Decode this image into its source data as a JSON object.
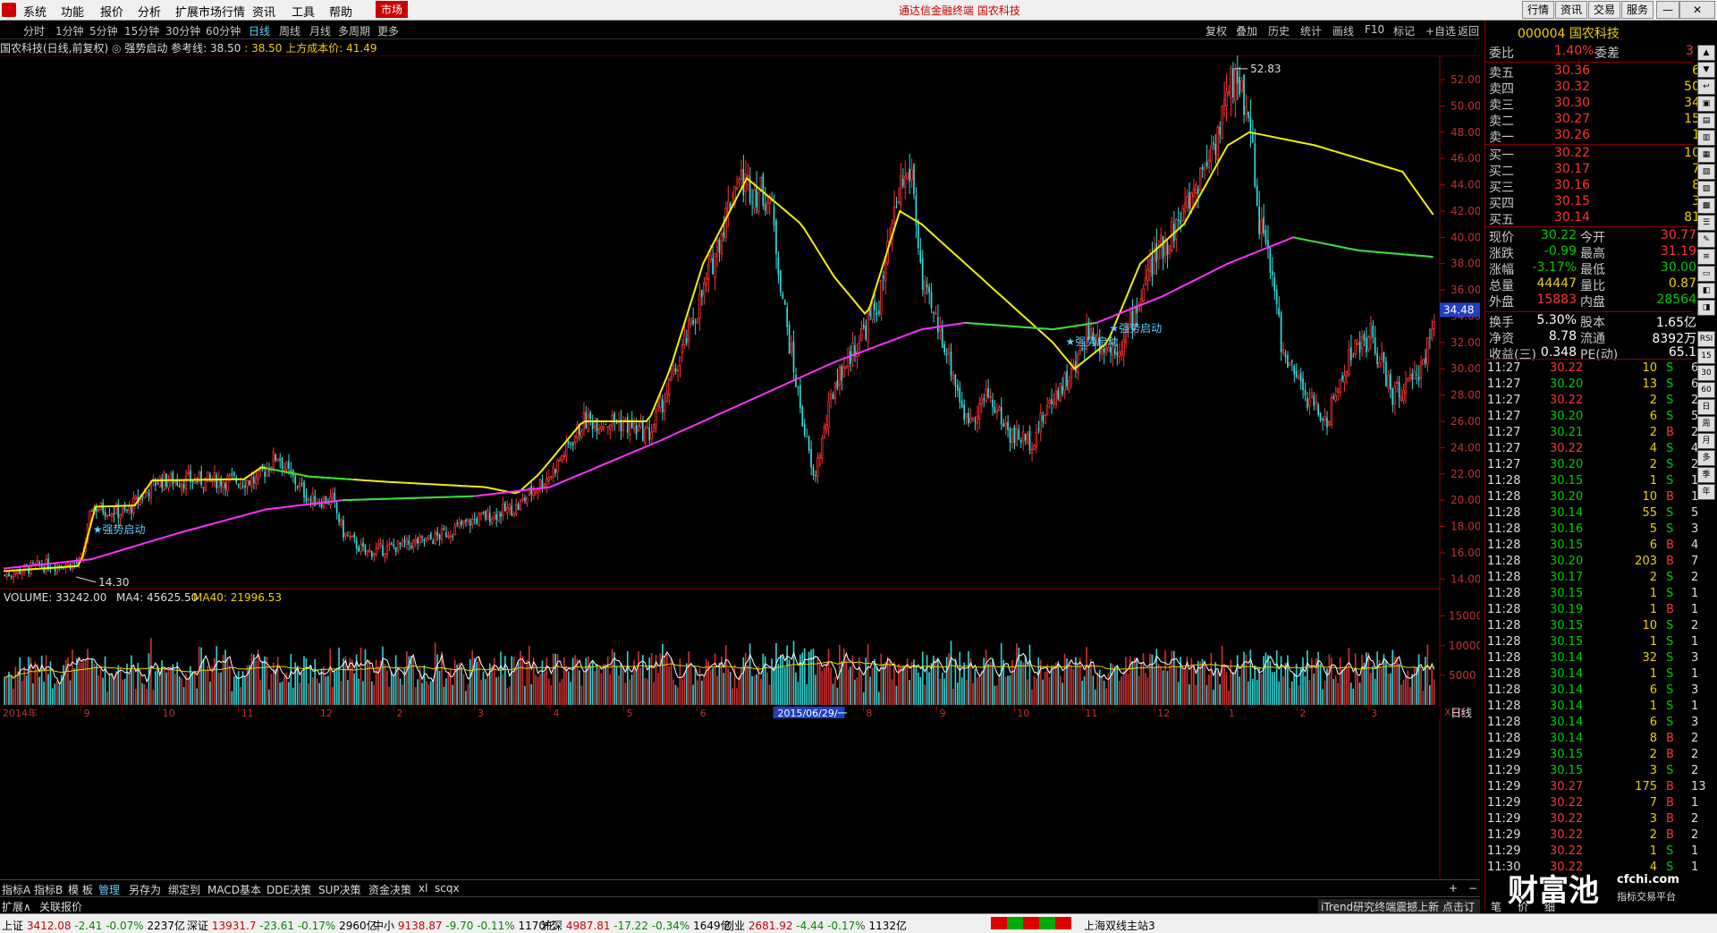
{
  "menu": {
    "items": [
      "系统",
      "功能",
      "报价",
      "分析",
      "扩展市场行情",
      "资讯",
      "工具",
      "帮助"
    ],
    "market": "市场",
    "center_title": "通达信金融终端 国农科技",
    "right_buttons": [
      "行情",
      "资讯",
      "交易",
      "服务"
    ]
  },
  "periods": {
    "items": [
      "分时",
      "1分钟",
      "5分钟",
      "15分钟",
      "30分钟",
      "60分钟",
      "日线",
      "周线",
      "月线",
      "多周期",
      "更多"
    ],
    "selected": "日线",
    "right_items": [
      "复权",
      "叠加",
      "历史",
      "统计",
      "画线",
      "F10",
      "标记",
      "+自选",
      "返回"
    ]
  },
  "chart_info": {
    "name": "国农科技(日线,前复权)",
    "indicator": "强势启动",
    "ref_label": "参考线: 38.50",
    "ref_value": ": 38.50",
    "cost_label": "上方成本价: 41.49"
  },
  "chart_data": {
    "type": "candlestick",
    "price_axis": [
      "52.00",
      "50.00",
      "48.00",
      "46.00",
      "44.00",
      "42.00",
      "40.00",
      "38.00",
      "36.00",
      "34.00",
      "32.00",
      "30.00",
      "28.00",
      "26.00",
      "24.00",
      "22.00",
      "20.00",
      "18.00",
      "16.00",
      "14.00"
    ],
    "price_range": [
      13.0,
      53.5
    ],
    "high_label": "52.83",
    "low_label": "14.30",
    "current_price_tag": "34.48",
    "signal_label": "★强势启动",
    "month_labels": [
      "2014年",
      "9",
      "10",
      "11",
      "12",
      "2",
      "3",
      "4",
      "5",
      "6",
      "2015/06/29/一",
      "8",
      "9",
      "10",
      "11",
      "12",
      "1",
      "2",
      "3"
    ],
    "selected_date": "2015/06/29/一",
    "period_tag": "日线",
    "price_anchors": [
      [
        0,
        14.3
      ],
      [
        15,
        15
      ],
      [
        35,
        15.2
      ],
      [
        40,
        19.5
      ],
      [
        55,
        19
      ],
      [
        70,
        21.5
      ],
      [
        95,
        21.5
      ],
      [
        115,
        21.5
      ],
      [
        125,
        23.5
      ],
      [
        130,
        22
      ],
      [
        140,
        20
      ],
      [
        150,
        20
      ],
      [
        155,
        17.5
      ],
      [
        165,
        16
      ],
      [
        180,
        16.5
      ],
      [
        195,
        17
      ],
      [
        215,
        18.5
      ],
      [
        235,
        19.5
      ],
      [
        240,
        20.5
      ],
      [
        250,
        22
      ],
      [
        265,
        26
      ],
      [
        280,
        26
      ],
      [
        295,
        25
      ],
      [
        305,
        29
      ],
      [
        320,
        36
      ],
      [
        335,
        44.5
      ],
      [
        350,
        43
      ],
      [
        358,
        33
      ],
      [
        362,
        29
      ],
      [
        370,
        21.5
      ],
      [
        380,
        29
      ],
      [
        390,
        32
      ],
      [
        400,
        35
      ],
      [
        410,
        44
      ],
      [
        415,
        45
      ],
      [
        420,
        36
      ],
      [
        430,
        32
      ],
      [
        440,
        26
      ],
      [
        450,
        28
      ],
      [
        460,
        25
      ],
      [
        470,
        24.5
      ],
      [
        480,
        28
      ],
      [
        490,
        30
      ],
      [
        495,
        33
      ],
      [
        505,
        31.5
      ],
      [
        512,
        32
      ],
      [
        525,
        38
      ],
      [
        540,
        42
      ],
      [
        555,
        48
      ],
      [
        563,
        52.5
      ],
      [
        570,
        49
      ],
      [
        573,
        42
      ],
      [
        580,
        37
      ],
      [
        585,
        31
      ],
      [
        595,
        28
      ],
      [
        605,
        26
      ],
      [
        615,
        31
      ],
      [
        625,
        32.5
      ],
      [
        635,
        28
      ],
      [
        645,
        29
      ],
      [
        655,
        33.5
      ]
    ],
    "ma_yellow": [
      [
        0,
        14.6
      ],
      [
        35,
        15
      ],
      [
        42,
        19.5
      ],
      [
        60,
        19.6
      ],
      [
        68,
        21.5
      ],
      [
        110,
        21.6
      ],
      [
        118,
        22.5
      ],
      [
        140,
        21.8
      ],
      [
        175,
        21.4
      ],
      [
        220,
        21
      ],
      [
        235,
        20.5
      ],
      [
        245,
        22
      ],
      [
        265,
        26
      ],
      [
        295,
        26
      ],
      [
        305,
        30
      ],
      [
        320,
        38
      ],
      [
        340,
        44.5
      ],
      [
        365,
        41
      ],
      [
        380,
        37
      ],
      [
        395,
        34
      ],
      [
        410,
        42
      ],
      [
        420,
        41
      ],
      [
        440,
        38
      ],
      [
        460,
        35
      ],
      [
        480,
        32
      ],
      [
        490,
        30
      ],
      [
        505,
        32
      ],
      [
        520,
        38
      ],
      [
        540,
        41
      ],
      [
        560,
        47
      ],
      [
        570,
        48
      ],
      [
        600,
        47
      ],
      [
        640,
        45
      ],
      [
        655,
        41.5
      ]
    ],
    "ma_green_magenta": [
      [
        0,
        14.8
      ],
      [
        40,
        15.5
      ],
      [
        80,
        17.5
      ],
      [
        120,
        19.3
      ],
      [
        155,
        20
      ],
      [
        215,
        20.3
      ],
      [
        250,
        21
      ],
      [
        300,
        24.5
      ],
      [
        340,
        27.5
      ],
      [
        380,
        30.5
      ],
      [
        420,
        33
      ],
      [
        440,
        33.5
      ],
      [
        480,
        33
      ],
      [
        500,
        33.5
      ],
      [
        530,
        35.5
      ],
      [
        560,
        38
      ],
      [
        590,
        40
      ],
      [
        620,
        39
      ],
      [
        655,
        38.5
      ]
    ],
    "volume": {
      "label": "VOLUME: 33242.00",
      "ma4_label": "MA4: 45625.50",
      "ma40_label": "MA40: 21996.53",
      "axis": [
        "15000",
        "10000",
        "5000"
      ],
      "tag": "X10"
    }
  },
  "quote": {
    "code": "000004",
    "name": "国农科技",
    "weibi": {
      "label": "委比",
      "value": "1.40%",
      "label2": "委差",
      "value2": "3"
    },
    "asks": [
      {
        "label": "卖五",
        "price": "30.36",
        "vol": "6"
      },
      {
        "label": "卖四",
        "price": "30.32",
        "vol": "50"
      },
      {
        "label": "卖三",
        "price": "30.30",
        "vol": "34"
      },
      {
        "label": "卖二",
        "price": "30.27",
        "vol": "15"
      },
      {
        "label": "卖一",
        "price": "30.26",
        "vol": "1"
      }
    ],
    "bids": [
      {
        "label": "买一",
        "price": "30.22",
        "vol": "10"
      },
      {
        "label": "买二",
        "price": "30.17",
        "vol": "7"
      },
      {
        "label": "买三",
        "price": "30.16",
        "vol": "8"
      },
      {
        "label": "买四",
        "price": "30.15",
        "vol": "3"
      },
      {
        "label": "买五",
        "price": "30.14",
        "vol": "81"
      }
    ],
    "stats": [
      {
        "l": "现价",
        "v": "30.22",
        "c": "dn",
        "l2": "今开",
        "v2": "30.77",
        "c2": "up"
      },
      {
        "l": "涨跌",
        "v": "-0.99",
        "c": "dn",
        "l2": "最高",
        "v2": "31.19",
        "c2": "up"
      },
      {
        "l": "涨幅",
        "v": "-3.17%",
        "c": "dn",
        "l2": "最低",
        "v2": "30.00",
        "c2": "dn"
      },
      {
        "l": "总量",
        "v": "44447",
        "c": "yl",
        "l2": "量比",
        "v2": "0.87",
        "c2": "yl"
      },
      {
        "l": "外盘",
        "v": "15883",
        "c": "up",
        "l2": "内盘",
        "v2": "28564",
        "c2": "dn"
      }
    ],
    "fin": [
      {
        "l": "换手",
        "v": "5.30%",
        "l2": "股本",
        "v2": "1.65亿"
      },
      {
        "l": "净资",
        "v": "8.78",
        "l2": "流通",
        "v2": "8392万"
      },
      {
        "l": "收益(三)",
        "v": "0.348",
        "l2": "PE(动)",
        "v2": "65.1"
      }
    ],
    "ticks": [
      [
        "11:27",
        "30.22",
        "10",
        "S",
        "6"
      ],
      [
        "11:27",
        "30.20",
        "13",
        "S",
        "6"
      ],
      [
        "11:27",
        "30.22",
        "2",
        "S",
        "2"
      ],
      [
        "11:27",
        "30.20",
        "6",
        "S",
        "5"
      ],
      [
        "11:27",
        "30.21",
        "2",
        "B",
        "2"
      ],
      [
        "11:27",
        "30.22",
        "4",
        "S",
        "4"
      ],
      [
        "11:27",
        "30.20",
        "2",
        "S",
        "2"
      ],
      [
        "11:28",
        "30.15",
        "1",
        "S",
        "1"
      ],
      [
        "11:28",
        "30.20",
        "10",
        "B",
        "1"
      ],
      [
        "11:28",
        "30.14",
        "55",
        "S",
        "5"
      ],
      [
        "11:28",
        "30.16",
        "5",
        "S",
        "3"
      ],
      [
        "11:28",
        "30.15",
        "6",
        "B",
        "4"
      ],
      [
        "11:28",
        "30.20",
        "203",
        "B",
        "7"
      ],
      [
        "11:28",
        "30.17",
        "2",
        "S",
        "2"
      ],
      [
        "11:28",
        "30.15",
        "1",
        "S",
        "1"
      ],
      [
        "11:28",
        "30.19",
        "1",
        "B",
        "1"
      ],
      [
        "11:28",
        "30.15",
        "10",
        "S",
        "2"
      ],
      [
        "11:28",
        "30.15",
        "1",
        "S",
        "1"
      ],
      [
        "11:28",
        "30.14",
        "32",
        "S",
        "3"
      ],
      [
        "11:28",
        "30.14",
        "1",
        "S",
        "1"
      ],
      [
        "11:28",
        "30.14",
        "6",
        "S",
        "3"
      ],
      [
        "11:28",
        "30.14",
        "1",
        "S",
        "1"
      ],
      [
        "11:28",
        "30.14",
        "6",
        "S",
        "3"
      ],
      [
        "11:28",
        "30.14",
        "8",
        "B",
        "2"
      ],
      [
        "11:29",
        "30.15",
        "2",
        "B",
        "2"
      ],
      [
        "11:29",
        "30.15",
        "3",
        "S",
        "2"
      ],
      [
        "11:29",
        "30.27",
        "175",
        "B",
        "13"
      ],
      [
        "11:29",
        "30.22",
        "7",
        "B",
        "1"
      ],
      [
        "11:29",
        "30.22",
        "3",
        "B",
        "2"
      ],
      [
        "11:29",
        "30.22",
        "2",
        "B",
        "2"
      ],
      [
        "11:29",
        "30.22",
        "1",
        "S",
        "1"
      ],
      [
        "11:30",
        "30.22",
        "4",
        "S",
        "1"
      ]
    ]
  },
  "sidebar": {
    "labels": [
      "RSI",
      "15",
      "30",
      "60",
      "日",
      "周",
      "月",
      "多",
      "季",
      "年"
    ]
  },
  "tabs": {
    "items": [
      "指标A",
      "指标B",
      "模 板",
      "管理",
      "另存为",
      "绑定到",
      "MACD基本",
      "DDE决策",
      "SUP决策",
      "资金决策",
      "xl",
      "scqx"
    ],
    "selected": "管理",
    "ext_items": [
      "扩展∧",
      "关联报价"
    ],
    "right_text": "iTrend研究终端震撼上新 点击订购",
    "btns": [
      "笔",
      "价",
      "细"
    ]
  },
  "status": {
    "items": [
      {
        "name": "上证",
        "value": "3412.08",
        "chg": "-2.41",
        "pct": "-0.07%",
        "amt": "2237亿"
      },
      {
        "name": "深证",
        "value": "13931.7",
        "chg": "-23.61",
        "pct": "-0.17%",
        "amt": "2960亿"
      },
      {
        "name": "中小",
        "value": "9138.87",
        "chg": "-9.70",
        "pct": "-0.11%",
        "amt": "1170亿"
      },
      {
        "name": "沪深",
        "value": "4987.81",
        "chg": "-17.22",
        "pct": "-0.34%",
        "amt": "1649亿"
      },
      {
        "name": "创业",
        "value": "2681.92",
        "chg": "-4.44",
        "pct": "-0.17%",
        "amt": "1132亿"
      }
    ],
    "server": "上海双线主站3",
    "watermark": "财富池",
    "watermark_url": "cfchi.com",
    "watermark_sub": "指标交易平台"
  }
}
